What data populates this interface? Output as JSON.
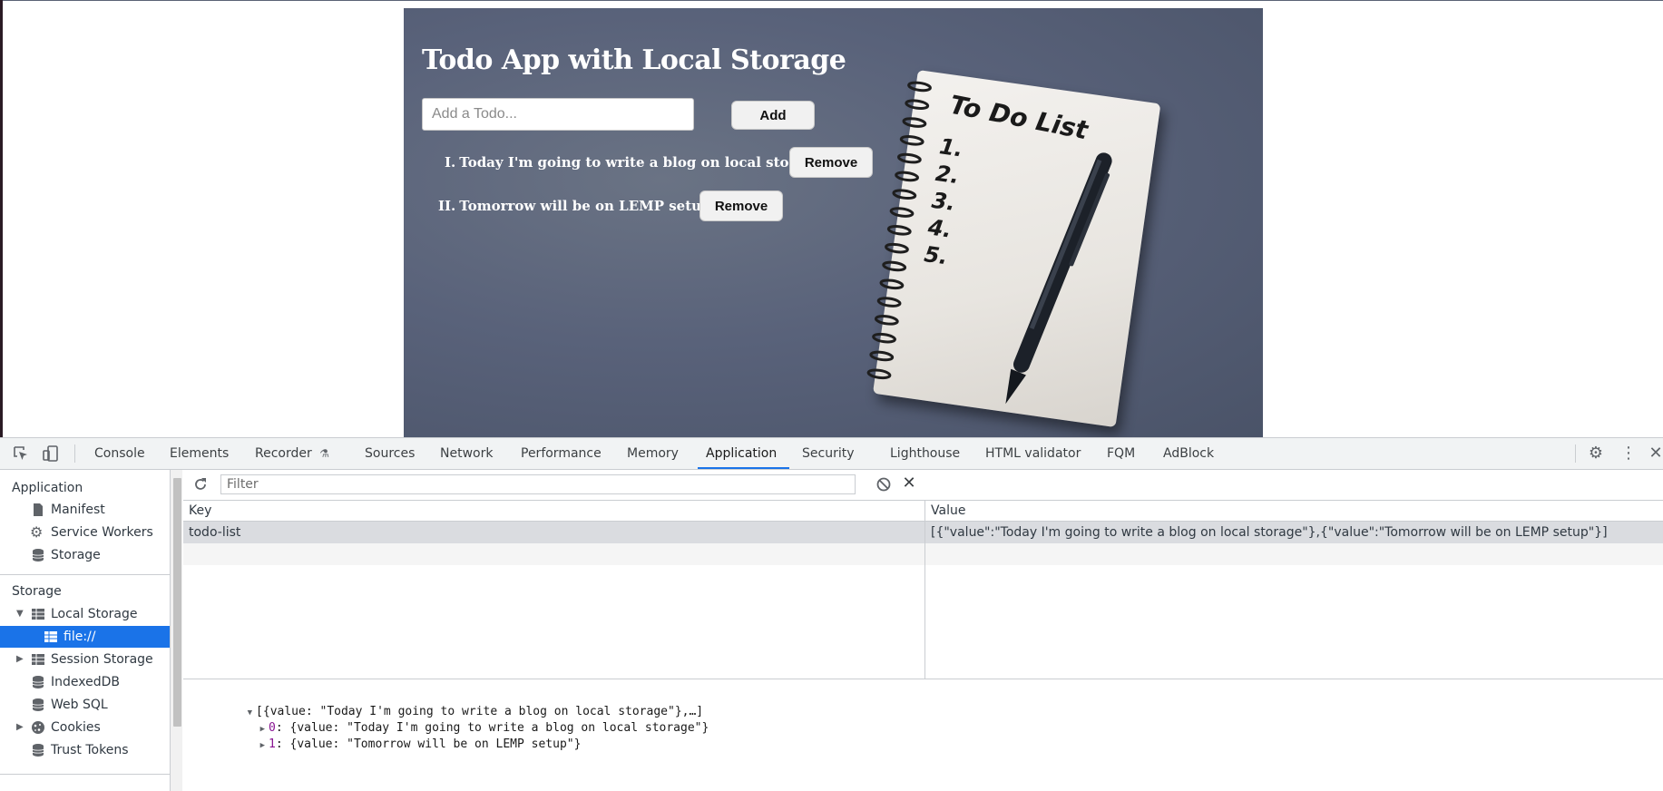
{
  "app": {
    "title": "Todo App with Local Storage",
    "input_placeholder": "Add a Todo...",
    "add_label": "Add",
    "todos": [
      {
        "num": "I.",
        "text": "Today I'm going to write a blog on local storage",
        "remove_label": "Remove"
      },
      {
        "num": "II.",
        "text": "Tomorrow will be on LEMP setup",
        "remove_label": "Remove"
      }
    ],
    "illustration": {
      "heading": "To Do List",
      "lines": [
        "1.",
        "2.",
        "3.",
        "4.",
        "5."
      ]
    }
  },
  "devtools": {
    "tabs": [
      "Console",
      "Elements",
      "Recorder",
      "Sources",
      "Network",
      "Performance",
      "Memory",
      "Application",
      "Security",
      "Lighthouse",
      "HTML validator",
      "FQM",
      "AdBlock"
    ],
    "active_tab": "Application",
    "sidebar": {
      "application_header": "Application",
      "application_items": [
        "Manifest",
        "Service Workers",
        "Storage"
      ],
      "storage_header": "Storage",
      "storage_items": {
        "local_storage": "Local Storage",
        "local_origin": "file://",
        "session_storage": "Session Storage",
        "indexeddb": "IndexedDB",
        "websql": "Web SQL",
        "cookies": "Cookies",
        "trust_tokens": "Trust Tokens"
      }
    },
    "filter_placeholder": "Filter",
    "table": {
      "headers": {
        "key": "Key",
        "value": "Value"
      },
      "rows": [
        {
          "key": "todo-list",
          "value": "[{\"value\":\"Today I'm going to write a blog on local storage\"},{\"value\":\"Tomorrow will be on LEMP setup\"}]"
        }
      ]
    },
    "preview": {
      "root": "[{value: \"Today I'm going to write a blog on local storage\"},…]",
      "items": [
        {
          "index": "0",
          "value": "{value: \"Today I'm going to write a blog on local storage\"}"
        },
        {
          "index": "1",
          "value": "{value: \"Tomorrow will be on LEMP setup\"}"
        }
      ]
    },
    "colors": {
      "accent": "#1a73e8",
      "selected_row": "#dadce0"
    }
  }
}
